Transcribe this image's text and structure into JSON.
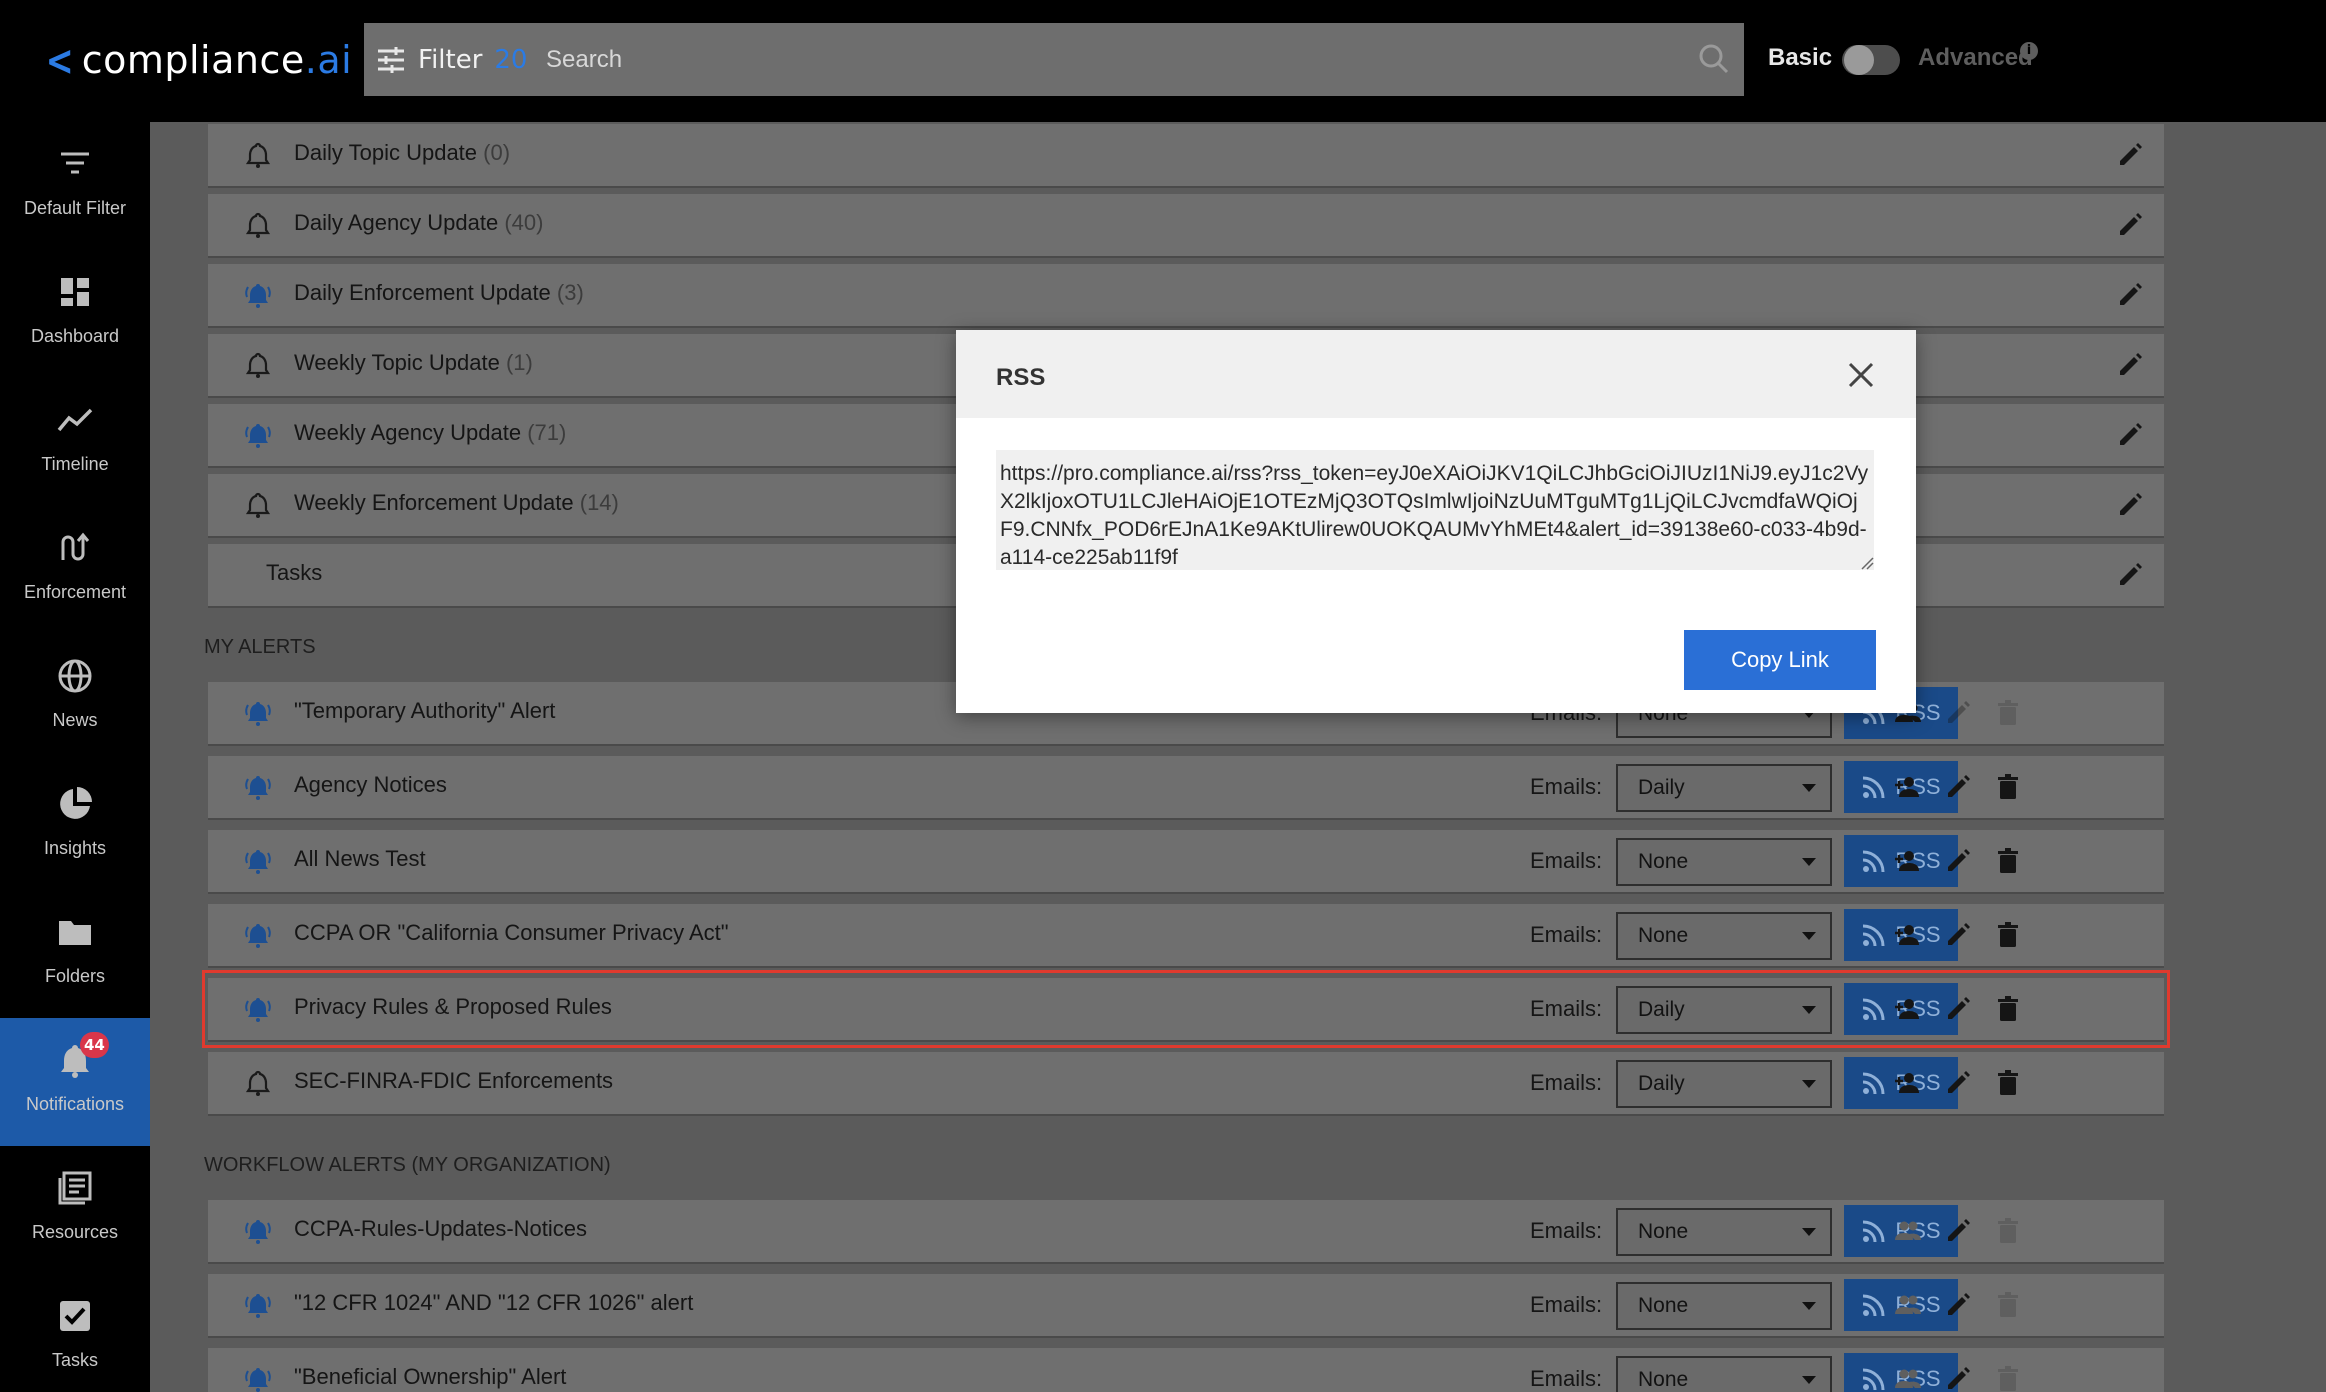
{
  "header": {
    "logo_prefix": "compliance",
    "logo_suffix": ".ai",
    "filter_label": "Filter",
    "filter_count": "20",
    "search_placeholder": "Search",
    "mode_basic": "Basic",
    "mode_advanced": "Advanced"
  },
  "sidebar": {
    "items": [
      {
        "label": "Default Filter",
        "icon": "filter-lines-icon"
      },
      {
        "label": "Dashboard",
        "icon": "dashboard-icon"
      },
      {
        "label": "Timeline",
        "icon": "timeline-icon"
      },
      {
        "label": "Enforcement",
        "icon": "enforcement-icon"
      },
      {
        "label": "News",
        "icon": "globe-icon"
      },
      {
        "label": "Insights",
        "icon": "pie-chart-icon"
      },
      {
        "label": "Folders",
        "icon": "folder-icon"
      },
      {
        "label": "Notifications",
        "icon": "bell-icon",
        "badge": "44",
        "active": true
      },
      {
        "label": "Resources",
        "icon": "resources-icon"
      },
      {
        "label": "Tasks",
        "icon": "checkbox-icon"
      }
    ]
  },
  "digest_rows": [
    {
      "title": "Daily Topic Update",
      "count": "(0)",
      "bell": "outline"
    },
    {
      "title": "Daily Agency Update",
      "count": "(40)",
      "bell": "outline"
    },
    {
      "title": "Daily Enforcement Update",
      "count": "(3)",
      "bell": "ringing"
    },
    {
      "title": "Weekly Topic Update",
      "count": "(1)",
      "bell": "outline"
    },
    {
      "title": "Weekly Agency Update",
      "count": "(71)",
      "bell": "ringing"
    },
    {
      "title": "Weekly Enforcement Update",
      "count": "(14)",
      "bell": "outline"
    },
    {
      "title": "Tasks",
      "count": "",
      "bell": "none"
    }
  ],
  "my_alerts": {
    "label": "MY ALERTS",
    "emails_label": "Emails:",
    "rss_label": "RSS",
    "rows": [
      {
        "title": "\"Temporary Authority\" Alert",
        "emails": "None"
      },
      {
        "title": "Agency Notices",
        "emails": "Daily"
      },
      {
        "title": "All News Test",
        "emails": "None"
      },
      {
        "title": "CCPA OR \"California Consumer Privacy Act\"",
        "emails": "None"
      },
      {
        "title": "Privacy Rules & Proposed Rules",
        "emails": "Daily",
        "highlighted": true
      },
      {
        "title": "SEC-FINRA-FDIC Enforcements",
        "emails": "Daily"
      }
    ]
  },
  "workflow_alerts": {
    "label": "WORKFLOW ALERTS (MY ORGANIZATION)",
    "rows": [
      {
        "title": "CCPA-Rules-Updates-Notices",
        "emails": "None"
      },
      {
        "title": "\"12 CFR 1024\" AND \"12 CFR 1026\" alert",
        "emails": "None"
      },
      {
        "title": "\"Beneficial Ownership\" Alert",
        "emails": "None"
      }
    ]
  },
  "modal": {
    "title": "RSS",
    "url": "https://pro.compliance.ai/rss?rss_token=eyJ0eXAiOiJKV1QiLCJhbGciOiJIUzI1NiJ9.eyJ1c2VyX2lkIjoxOTU1LCJleHAiOjE1OTEzMjQ3OTQsImlwIjoiNzUuMTguMTg1LjQiLCJvcmdfaWQiOjF9.CNNfx_POD6rEJnA1Ke9AKtUlirew0UOKQAUMvYhMEt4&alert_id=39138e60-c033-4b9d-a114-ce225ab11f9f",
    "copy_label": "Copy Link"
  },
  "colors": {
    "accent": "#2a6fd6",
    "rss_button": "#1a4a88",
    "highlight": "#e03a2e",
    "badge": "#d9364a"
  }
}
